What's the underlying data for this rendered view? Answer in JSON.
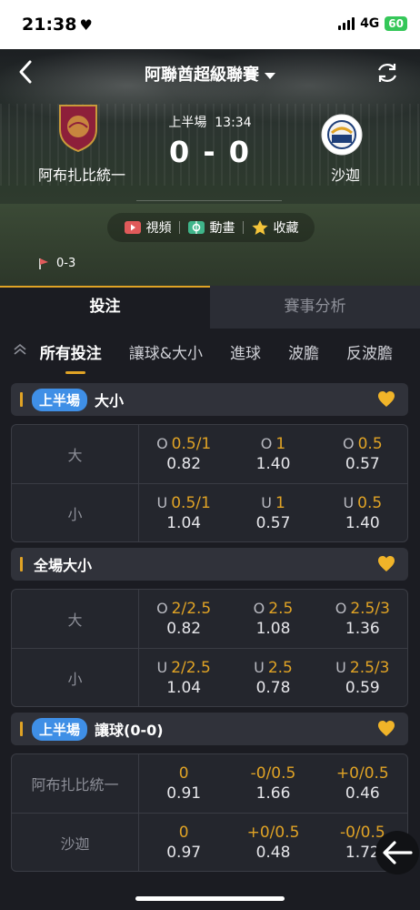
{
  "status": {
    "time": "21:38",
    "heart": "♥",
    "network": "4G",
    "battery": "60"
  },
  "header": {
    "league": "阿聯酋超級聯賽",
    "period": "上半場",
    "clock": "13:34",
    "score": "0 - 0",
    "home_team": "阿布扎比統一",
    "away_team": "沙迦",
    "media": {
      "video": "視頻",
      "animation": "動畫",
      "favorite": "收藏"
    },
    "corners": "0-3"
  },
  "tabs": [
    "投注",
    "賽事分析"
  ],
  "subtabs": [
    "所有投注",
    "讓球&大小",
    "進球",
    "波膽",
    "反波膽"
  ],
  "sections": [
    {
      "pill": "上半場",
      "title": "大小",
      "rows": [
        {
          "label": "大",
          "cells": [
            {
              "p": "O",
              "line": "0.5/1",
              "odds": "0.82"
            },
            {
              "p": "O",
              "line": "1",
              "odds": "1.40"
            },
            {
              "p": "O",
              "line": "0.5",
              "odds": "0.57"
            }
          ]
        },
        {
          "label": "小",
          "cells": [
            {
              "p": "U",
              "line": "0.5/1",
              "odds": "1.04"
            },
            {
              "p": "U",
              "line": "1",
              "odds": "0.57"
            },
            {
              "p": "U",
              "line": "0.5",
              "odds": "1.40"
            }
          ]
        }
      ]
    },
    {
      "pill": "",
      "title": "全場大小",
      "rows": [
        {
          "label": "大",
          "cells": [
            {
              "p": "O",
              "line": "2/2.5",
              "odds": "0.82"
            },
            {
              "p": "O",
              "line": "2.5",
              "odds": "1.08"
            },
            {
              "p": "O",
              "line": "2.5/3",
              "odds": "1.36"
            }
          ]
        },
        {
          "label": "小",
          "cells": [
            {
              "p": "U",
              "line": "2/2.5",
              "odds": "1.04"
            },
            {
              "p": "U",
              "line": "2.5",
              "odds": "0.78"
            },
            {
              "p": "U",
              "line": "2.5/3",
              "odds": "0.59"
            }
          ]
        }
      ]
    },
    {
      "pill": "上半場",
      "title": "讓球(0-0)",
      "rows": [
        {
          "label": "阿布扎比統一",
          "cells": [
            {
              "p": "",
              "line": "0",
              "odds": "0.91"
            },
            {
              "p": "",
              "line": "-0/0.5",
              "odds": "1.66"
            },
            {
              "p": "",
              "line": "+0/0.5",
              "odds": "0.46"
            }
          ]
        },
        {
          "label": "沙迦",
          "cells": [
            {
              "p": "",
              "line": "0",
              "odds": "0.97"
            },
            {
              "p": "",
              "line": "+0/0.5",
              "odds": "0.48"
            },
            {
              "p": "",
              "line": "-0/0.5",
              "odds": "1.72"
            }
          ]
        }
      ]
    }
  ],
  "colors": {
    "accent": "#e0a325",
    "pill": "#3f8fe6",
    "background": "#1b1c22"
  },
  "icons": [
    "back-arrow-icon",
    "refresh-icon",
    "video-icon",
    "animation-icon",
    "star-icon",
    "corner-flag-icon",
    "heart-icon",
    "collapse-up-icon"
  ]
}
